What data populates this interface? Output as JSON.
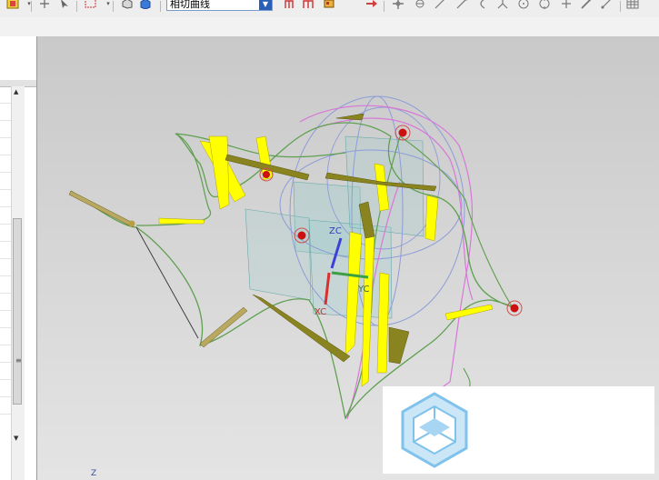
{
  "toolbar": {
    "curve_type_value": "相切曲线",
    "dropdown_arrow": "▼"
  },
  "left_panel": {
    "grip": "≡",
    "scroll_up": "▲",
    "scroll_down": "▼"
  },
  "viewport": {
    "triad_labels": {
      "zc": "ZC",
      "yc": "YC",
      "xc": "XC"
    },
    "corner_axis_label": "Z"
  },
  "colors": {
    "curve_green": "#5fa050",
    "magenta_curve": "#d878d8",
    "blue_circle": "#8c9cd8",
    "yellow_band": "#ffff00",
    "olive_band": "#8a8420",
    "point_red": "#cc1010",
    "logo_blue": "#7fc2ec"
  },
  "icons": [
    "new-color-icon",
    "snap-icon",
    "arrow-select-icon",
    "rect-select-icon",
    "box-icon",
    "cube-icon",
    "fork-icon",
    "fork-red-icon",
    "flag-icon",
    "arrow-right-icon",
    "move-icon",
    "rotate-icon",
    "line-icon",
    "line2-icon",
    "arc-icon",
    "tripod-icon",
    "circle-icon",
    "crosshair-icon",
    "plus-icon",
    "pencil-icon",
    "grid-icon"
  ]
}
